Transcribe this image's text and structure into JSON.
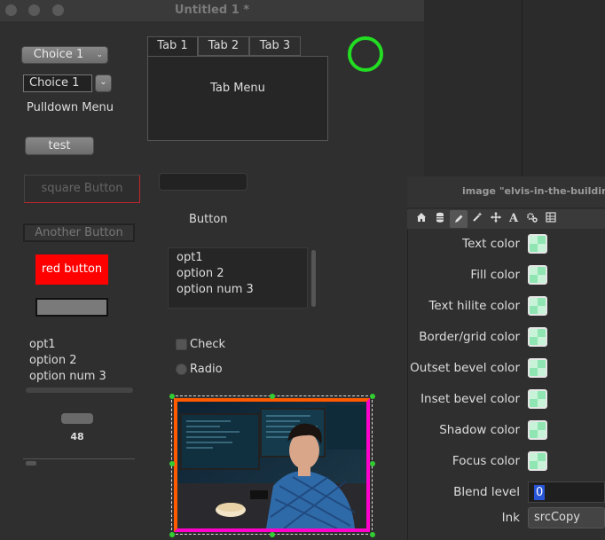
{
  "window": {
    "title": "Untitled 1 *"
  },
  "controls": {
    "choice_popup": "Choice 1",
    "choice_combo": "Choice 1",
    "pulldown_label": "Pulldown Menu",
    "test_button": "test",
    "square_button": "square Button",
    "another_button": "Another Button",
    "red_button": "red button",
    "list_left": [
      "opt1",
      "option 2",
      "option num 3"
    ],
    "slider_value": "48",
    "tabs": [
      "Tab 1",
      "Tab 2",
      "Tab 3"
    ],
    "tab_content": "Tab Menu",
    "plain_button": "Button",
    "list_center": [
      "opt1",
      "option 2",
      "option num 3"
    ],
    "checkbox_label": "Check",
    "radio_label": "Radio"
  },
  "inspector": {
    "title": "image \"elvis-in-the-building...",
    "tools": [
      "home-icon",
      "database-icon",
      "pencil-icon",
      "wand-icon",
      "move-icon",
      "text-icon",
      "gears-icon",
      "table-icon"
    ],
    "text_tool_glyph": "A",
    "properties": [
      {
        "label": "Text color",
        "swatch": "#8fe6b2"
      },
      {
        "label": "Fill color",
        "swatch": "#8fe6b2"
      },
      {
        "label": "Text hilite color",
        "swatch": "#8fe6b2"
      },
      {
        "label": "Border/grid color",
        "swatch": "#8fe6b2"
      },
      {
        "label": "Outset bevel color",
        "swatch": "#8fe6b2"
      },
      {
        "label": "Inset bevel color",
        "swatch": "#8fe6b2"
      },
      {
        "label": "Shadow color",
        "swatch": "#8fe6b2"
      },
      {
        "label": "Focus color",
        "swatch": "#8fe6b2"
      }
    ],
    "blend_level_label": "Blend level",
    "blend_level_value": "0",
    "ink_label": "Ink",
    "ink_value": "srcCopy"
  },
  "colors": {
    "accent_green": "#22dd22",
    "red_button": "#ff0000",
    "image_border_orange": "#ff5a00",
    "image_border_magenta": "#ff00cc",
    "selection_blue": "#2855d6"
  }
}
